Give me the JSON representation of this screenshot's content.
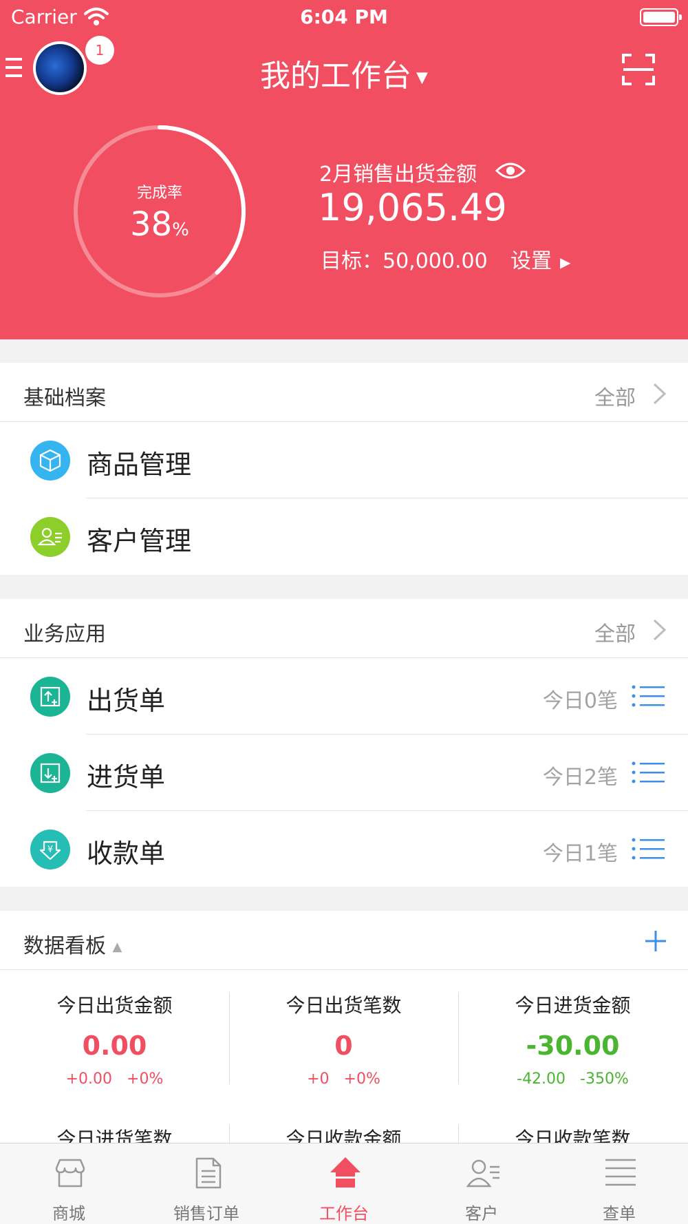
{
  "status_bar": {
    "carrier": "Carrier",
    "time": "6:04 PM"
  },
  "header": {
    "title": "我的工作台",
    "avatar_badge": "1",
    "completion_label": "完成率",
    "completion_value": "38",
    "completion_unit": "%",
    "completion_ratio": 0.38,
    "sales_label": "2月销售出货金额",
    "sales_amount": "19,065.49",
    "target_text": "目标：50,000.00",
    "settings_label": "设置"
  },
  "basic": {
    "title": "基础档案",
    "all_label": "全部",
    "items": [
      {
        "label": "商品管理",
        "icon": "box-icon",
        "color": "#35b4f0"
      },
      {
        "label": "客户管理",
        "icon": "customer-card-icon",
        "color": "#8ccf2a"
      }
    ]
  },
  "business": {
    "title": "业务应用",
    "all_label": "全部",
    "items": [
      {
        "label": "出货单",
        "count": "今日0笔",
        "icon": "outbound-icon",
        "color": "#1bb596"
      },
      {
        "label": "进货单",
        "count": "今日2笔",
        "icon": "inbound-icon",
        "color": "#1bb596"
      },
      {
        "label": "收款单",
        "count": "今日1笔",
        "icon": "receipt-icon",
        "color": "#26bdb5"
      }
    ]
  },
  "dashboard": {
    "title": "数据看板",
    "metrics": [
      {
        "label": "今日出货金额",
        "value": "0.00",
        "delta": "+0.00   +0%",
        "tone": "red"
      },
      {
        "label": "今日出货笔数",
        "value": "0",
        "delta": "+0   +0%",
        "tone": "red"
      },
      {
        "label": "今日进货金额",
        "value": "-30.00",
        "delta": "-42.00   -350%",
        "tone": "green"
      },
      {
        "label": "今日进货笔数"
      },
      {
        "label": "今日收款金额"
      },
      {
        "label": "今日收款笔数"
      }
    ]
  },
  "tabbar": {
    "tabs": [
      {
        "label": "商城",
        "icon": "store-icon"
      },
      {
        "label": "销售订单",
        "icon": "document-icon"
      },
      {
        "label": "工作台",
        "icon": "home-icon",
        "active": true
      },
      {
        "label": "客户",
        "icon": "contact-icon"
      },
      {
        "label": "查单",
        "icon": "list-icon"
      }
    ]
  },
  "colors": {
    "brand": "#f24e62",
    "link_blue": "#3b8fe6",
    "positive": "#49b530"
  }
}
